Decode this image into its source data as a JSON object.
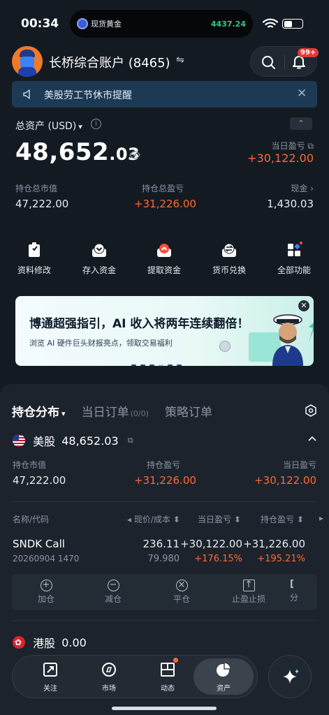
{
  "status_bar": {
    "time": "00:34",
    "ticker_label": "现货黄金",
    "ticker_value": "4437.24"
  },
  "account": {
    "name": "长桥综合账户 (8465)",
    "swap_icon": "⇋",
    "notification_badge": "99+"
  },
  "notice": {
    "text": "美股劳工节休市提醒"
  },
  "assets": {
    "total_label": "总资产 (USD)",
    "total_int": "48,652",
    "total_dec": ".03",
    "day_pnl_label": "当日盈亏",
    "day_pnl_value": "+30,122.00",
    "market_value_label": "持仓总市值",
    "market_value": "47,222.00",
    "position_pnl_label": "持仓总盈亏",
    "position_pnl": "+31,226.00",
    "cash_label": "现金 ›",
    "cash": "1,430.03"
  },
  "actions": [
    {
      "label": "资料修改",
      "icon": "profile-edit-icon"
    },
    {
      "label": "存入资金",
      "icon": "deposit-icon"
    },
    {
      "label": "提取资金",
      "icon": "withdraw-icon"
    },
    {
      "label": "货币兑换",
      "icon": "currency-exchange-icon"
    },
    {
      "label": "全部功能",
      "icon": "all-functions-icon"
    }
  ],
  "banner": {
    "title": "博通超强指引，AI 收入将两年连续翻倍！",
    "subtitle": "浏览 AI 硬件巨头财报亮点，领取交易福利"
  },
  "tabs": {
    "holdings": "持仓分布",
    "orders": "当日订单",
    "orders_count": "(0/0)",
    "strategy": "策略订单"
  },
  "us_market": {
    "name": "美股",
    "value": "48,652.03",
    "market_value_label": "持仓市值",
    "market_value": "47,222.00",
    "position_pnl_label": "持仓盈亏",
    "position_pnl": "+31,226.00",
    "day_pnl_label": "当日盈亏",
    "day_pnl": "+30,122.00"
  },
  "table": {
    "headers": {
      "name": "名称/代码",
      "price": "◂ 现价/成本 ⬍",
      "day_pnl": "当日盈亏 ⬍",
      "pos_pnl": "持仓盈亏 ⬍",
      "more": "▸"
    },
    "rows": [
      {
        "symbol": "SNDK Call",
        "code": "20260904 1470",
        "price": "236.11",
        "cost": "79.980",
        "day_pnl": "+30,122.00",
        "day_pct": "+176.15%",
        "pos_pnl": "+31,226.00",
        "pos_pct": "+195.21%"
      }
    ]
  },
  "ops": [
    {
      "label": "加仓",
      "icon": "add-position-icon",
      "glyph": "+"
    },
    {
      "label": "减仓",
      "icon": "reduce-position-icon",
      "glyph": "−"
    },
    {
      "label": "平仓",
      "icon": "close-position-icon",
      "glyph": "×"
    },
    {
      "label": "止盈止损",
      "icon": "take-profit-icon",
      "glyph": "↑"
    },
    {
      "label": "分",
      "icon": "share-icon",
      "glyph": "["
    }
  ],
  "hk_market": {
    "name": "港股",
    "value": "0.00"
  },
  "tabbar": [
    {
      "label": "关注",
      "icon": "watchlist-icon"
    },
    {
      "label": "市场",
      "icon": "market-icon"
    },
    {
      "label": "动态",
      "icon": "feed-icon"
    },
    {
      "label": "资产",
      "icon": "assets-icon"
    }
  ],
  "colors": {
    "up": "#ff6a2f",
    "bg": "#141a22",
    "panel": "#1c232c",
    "notice": "#1d3a55"
  }
}
